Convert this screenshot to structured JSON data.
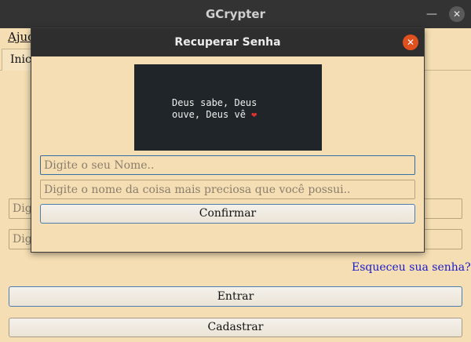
{
  "window": {
    "title": "GCrypter",
    "min_glyph": "—",
    "close_glyph": "✕"
  },
  "menu": {
    "help": "Ajuda"
  },
  "tabs": [
    {
      "label": "Inicio"
    }
  ],
  "main": {
    "user_placeholder": "Digite o seu Nome..",
    "pass_placeholder": "Digite a sua senha..",
    "forgot_link": "Esqueceu sua senha?",
    "enter_button": "Entrar",
    "register_button": "Cadastrar"
  },
  "dialog": {
    "title": "Recuperar Senha",
    "close_glyph": "✕",
    "image_text_line1": "Deus sabe, Deus",
    "image_text_line2": "ouve, Deus vê",
    "heart": "❤",
    "name_placeholder": "Digite o seu Nome..",
    "secret_placeholder": "Digite o nome da coisa mais preciosa que você possui..",
    "confirm_button": "Confirmar"
  },
  "colors": {
    "background": "#f5deb3",
    "titlebar": "#333333",
    "close_accent": "#e0501f",
    "link": "#1a1acc"
  }
}
